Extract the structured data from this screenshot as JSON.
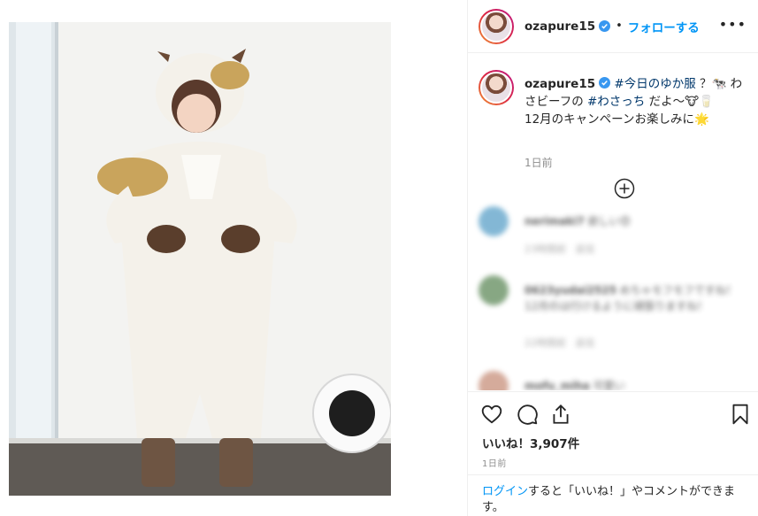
{
  "post": {
    "username": "ozapure15",
    "dot": "•",
    "follow_label": "フォローする",
    "more_label": "•••",
    "caption": {
      "username": "ozapure15",
      "tag1": "#今日のゆか服",
      "text1": " ？🐄 わさビーフの ",
      "tag2": "#わさっち",
      "text2": " だよ〜🐮🥛",
      "line2": "12月のキャンペーンお楽しみに🌟",
      "time": "1日前"
    },
    "comments": [
      {
        "user": "nerimaki7",
        "text": "欲しい😍",
        "time": "23時間前",
        "reply": "返信"
      },
      {
        "user": "0623yudai2525",
        "text": "めちゃモフモフですね！12月のは行けるように頑張りますね！",
        "time": "22時間前",
        "reply": "返信"
      },
      {
        "user": "mofu_miha",
        "text": "可愛い",
        "time": "",
        "reply": ""
      }
    ],
    "likes": "いいね！3,907件",
    "post_time": "1日前",
    "login_link": "ログイン",
    "login_text": "すると「いいね！」やコメントができます。"
  },
  "icons": [
    "verified-badge-icon",
    "plus-circle-icon",
    "heart-icon",
    "comment-icon",
    "share-icon",
    "bookmark-icon"
  ],
  "colors": {
    "link": "#0095f6",
    "hashtag": "#00376b",
    "muted": "#8e8e8e",
    "border": "#efefef"
  }
}
